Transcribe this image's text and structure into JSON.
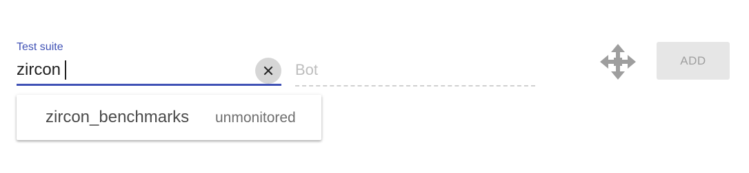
{
  "suite_field": {
    "label": "Test suite",
    "value": "zircon",
    "clear_icon": "close-icon"
  },
  "bot_field": {
    "placeholder": "Bot",
    "value": ""
  },
  "drag_handle": {
    "icon": "move-arrows-icon"
  },
  "add_button": {
    "label": "ADD"
  },
  "suggestions": [
    {
      "name": "zircon_benchmarks",
      "tag": "unmonitored"
    }
  ],
  "colors": {
    "accent": "#3f51b5",
    "clear_button_bg": "#d6d6d6",
    "disabled_button_bg": "#e6e6e6",
    "disabled_text": "#9e9e9e",
    "icon_gray": "#9e9e9e"
  }
}
